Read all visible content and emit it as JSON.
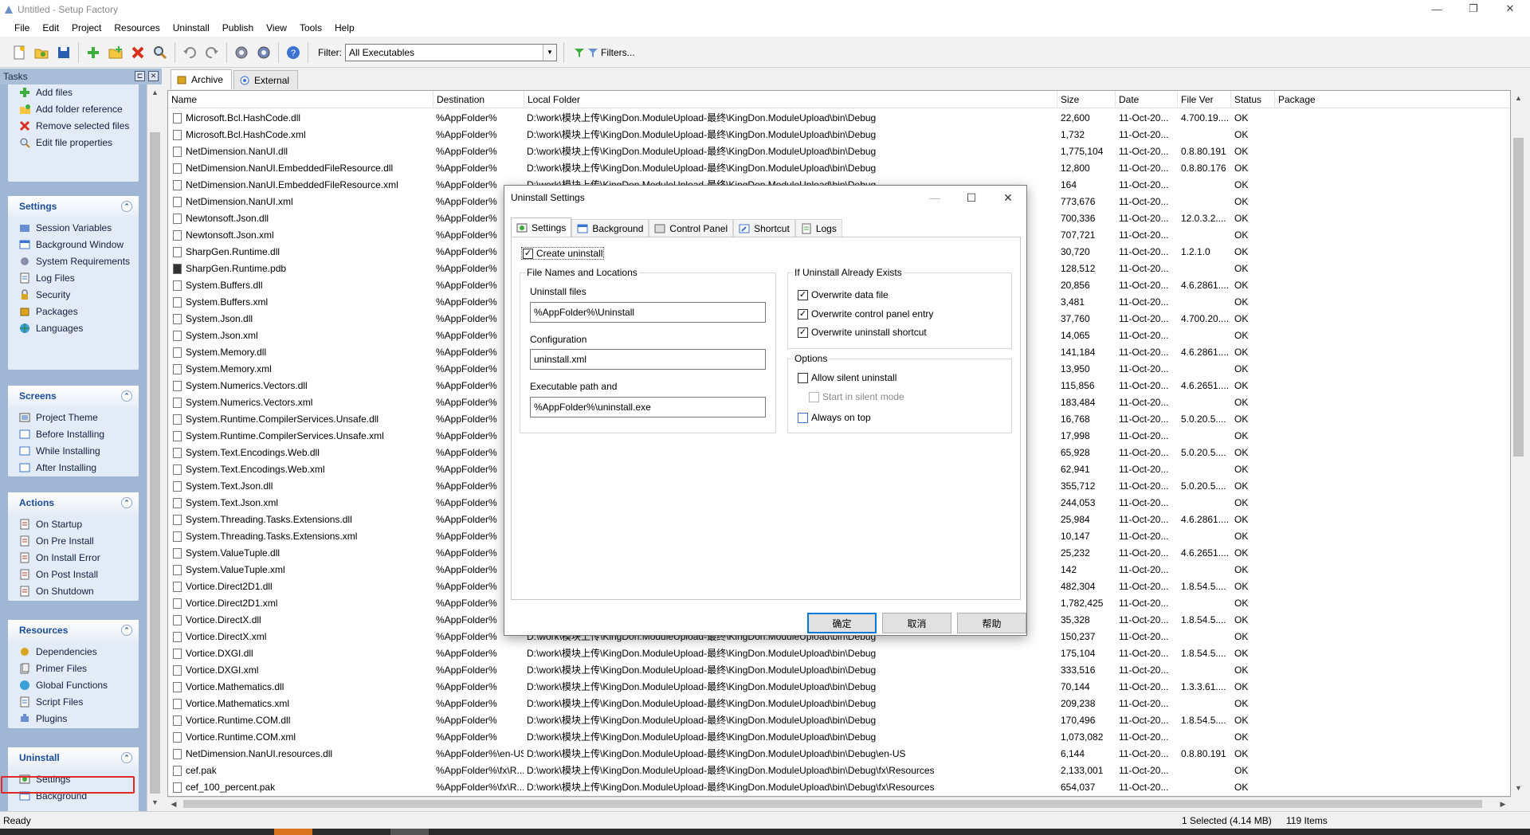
{
  "window": {
    "title": "Untitled - Setup Factory",
    "controls": [
      "—",
      "❐",
      "✕"
    ]
  },
  "menu": [
    "File",
    "Edit",
    "Project",
    "Resources",
    "Uninstall",
    "Publish",
    "View",
    "Tools",
    "Help"
  ],
  "toolbar": {
    "filter_label": "Filter:",
    "filter_value": "All Executables",
    "filters_button": "Filters..."
  },
  "tasks_panel": {
    "title": "Tasks",
    "top_items": [
      "Add files",
      "Add folder reference",
      "Remove selected files",
      "Edit file properties"
    ],
    "groups": [
      {
        "title": "Settings",
        "items": [
          "Session Variables",
          "Background Window",
          "System Requirements",
          "Log Files",
          "Security",
          "Packages",
          "Languages"
        ]
      },
      {
        "title": "Screens",
        "items": [
          "Project Theme",
          "Before Installing",
          "While Installing",
          "After Installing"
        ]
      },
      {
        "title": "Actions",
        "items": [
          "On Startup",
          "On Pre Install",
          "On Install Error",
          "On Post Install",
          "On Shutdown"
        ]
      },
      {
        "title": "Resources",
        "items": [
          "Dependencies",
          "Primer Files",
          "Global Functions",
          "Script Files",
          "Plugins"
        ]
      },
      {
        "title": "Uninstall",
        "items": [
          "Settings",
          "Background"
        ]
      }
    ]
  },
  "tabs": [
    "Archive",
    "External"
  ],
  "columns": [
    "Name",
    "Destination",
    "Local Folder",
    "Size",
    "Date",
    "File Ver",
    "Status",
    "Package"
  ],
  "files": [
    [
      "Microsoft.Bcl.HashCode.dll",
      "%AppFolder%",
      "D:\\work\\模块上传\\KingDon.ModuleUpload-最终\\KingDon.ModuleUpload\\bin\\Debug",
      "22,600",
      "11-Oct-20...",
      "4.700.19....",
      "OK"
    ],
    [
      "Microsoft.Bcl.HashCode.xml",
      "%AppFolder%",
      "D:\\work\\模块上传\\KingDon.ModuleUpload-最终\\KingDon.ModuleUpload\\bin\\Debug",
      "1,732",
      "11-Oct-20...",
      "",
      "OK"
    ],
    [
      "NetDimension.NanUI.dll",
      "%AppFolder%",
      "D:\\work\\模块上传\\KingDon.ModuleUpload-最终\\KingDon.ModuleUpload\\bin\\Debug",
      "1,775,104",
      "11-Oct-20...",
      "0.8.80.191",
      "OK"
    ],
    [
      "NetDimension.NanUI.EmbeddedFileResource.dll",
      "%AppFolder%",
      "D:\\work\\模块上传\\KingDon.ModuleUpload-最终\\KingDon.ModuleUpload\\bin\\Debug",
      "12,800",
      "11-Oct-20...",
      "0.8.80.176",
      "OK"
    ],
    [
      "NetDimension.NanUI.EmbeddedFileResource.xml",
      "%AppFolder%",
      "D:\\work\\模块上传\\KingDon.ModuleUpload-最终\\KingDon.ModuleUpload\\bin\\Debug",
      "164",
      "11-Oct-20...",
      "",
      "OK"
    ],
    [
      "NetDimension.NanUI.xml",
      "%AppFolder%",
      "",
      "773,676",
      "11-Oct-20...",
      "",
      "OK"
    ],
    [
      "Newtonsoft.Json.dll",
      "%AppFolder%",
      "",
      "700,336",
      "11-Oct-20...",
      "12.0.3.2....",
      "OK"
    ],
    [
      "Newtonsoft.Json.xml",
      "%AppFolder%",
      "",
      "707,721",
      "11-Oct-20...",
      "",
      "OK"
    ],
    [
      "SharpGen.Runtime.dll",
      "%AppFolder%",
      "",
      "30,720",
      "11-Oct-20...",
      "1.2.1.0",
      "OK"
    ],
    [
      "SharpGen.Runtime.pdb",
      "%AppFolder%",
      "",
      "128,512",
      "11-Oct-20...",
      "",
      "OK"
    ],
    [
      "System.Buffers.dll",
      "%AppFolder%",
      "",
      "20,856",
      "11-Oct-20...",
      "4.6.2861....",
      "OK"
    ],
    [
      "System.Buffers.xml",
      "%AppFolder%",
      "",
      "3,481",
      "11-Oct-20...",
      "",
      "OK"
    ],
    [
      "System.Json.dll",
      "%AppFolder%",
      "",
      "37,760",
      "11-Oct-20...",
      "4.700.20....",
      "OK"
    ],
    [
      "System.Json.xml",
      "%AppFolder%",
      "",
      "14,065",
      "11-Oct-20...",
      "",
      "OK"
    ],
    [
      "System.Memory.dll",
      "%AppFolder%",
      "",
      "141,184",
      "11-Oct-20...",
      "4.6.2861....",
      "OK"
    ],
    [
      "System.Memory.xml",
      "%AppFolder%",
      "",
      "13,950",
      "11-Oct-20...",
      "",
      "OK"
    ],
    [
      "System.Numerics.Vectors.dll",
      "%AppFolder%",
      "",
      "115,856",
      "11-Oct-20...",
      "4.6.2651....",
      "OK"
    ],
    [
      "System.Numerics.Vectors.xml",
      "%AppFolder%",
      "",
      "183,484",
      "11-Oct-20...",
      "",
      "OK"
    ],
    [
      "System.Runtime.CompilerServices.Unsafe.dll",
      "%AppFolder%",
      "",
      "16,768",
      "11-Oct-20...",
      "5.0.20.5....",
      "OK"
    ],
    [
      "System.Runtime.CompilerServices.Unsafe.xml",
      "%AppFolder%",
      "",
      "17,998",
      "11-Oct-20...",
      "",
      "OK"
    ],
    [
      "System.Text.Encodings.Web.dll",
      "%AppFolder%",
      "",
      "65,928",
      "11-Oct-20...",
      "5.0.20.5....",
      "OK"
    ],
    [
      "System.Text.Encodings.Web.xml",
      "%AppFolder%",
      "",
      "62,941",
      "11-Oct-20...",
      "",
      "OK"
    ],
    [
      "System.Text.Json.dll",
      "%AppFolder%",
      "",
      "355,712",
      "11-Oct-20...",
      "5.0.20.5....",
      "OK"
    ],
    [
      "System.Text.Json.xml",
      "%AppFolder%",
      "",
      "244,053",
      "11-Oct-20...",
      "",
      "OK"
    ],
    [
      "System.Threading.Tasks.Extensions.dll",
      "%AppFolder%",
      "",
      "25,984",
      "11-Oct-20...",
      "4.6.2861....",
      "OK"
    ],
    [
      "System.Threading.Tasks.Extensions.xml",
      "%AppFolder%",
      "",
      "10,147",
      "11-Oct-20...",
      "",
      "OK"
    ],
    [
      "System.ValueTuple.dll",
      "%AppFolder%",
      "",
      "25,232",
      "11-Oct-20...",
      "4.6.2651....",
      "OK"
    ],
    [
      "System.ValueTuple.xml",
      "%AppFolder%",
      "",
      "142",
      "11-Oct-20...",
      "",
      "OK"
    ],
    [
      "Vortice.Direct2D1.dll",
      "%AppFolder%",
      "",
      "482,304",
      "11-Oct-20...",
      "1.8.54.5....",
      "OK"
    ],
    [
      "Vortice.Direct2D1.xml",
      "%AppFolder%",
      "",
      "1,782,425",
      "11-Oct-20...",
      "",
      "OK"
    ],
    [
      "Vortice.DirectX.dll",
      "%AppFolder%",
      "",
      "35,328",
      "11-Oct-20...",
      "1.8.54.5....",
      "OK"
    ],
    [
      "Vortice.DirectX.xml",
      "%AppFolder%",
      "D:\\work\\模块上传\\KingDon.ModuleUpload-最终\\KingDon.ModuleUpload\\bin\\Debug",
      "150,237",
      "11-Oct-20...",
      "",
      "OK"
    ],
    [
      "Vortice.DXGI.dll",
      "%AppFolder%",
      "D:\\work\\模块上传\\KingDon.ModuleUpload-最终\\KingDon.ModuleUpload\\bin\\Debug",
      "175,104",
      "11-Oct-20...",
      "1.8.54.5....",
      "OK"
    ],
    [
      "Vortice.DXGI.xml",
      "%AppFolder%",
      "D:\\work\\模块上传\\KingDon.ModuleUpload-最终\\KingDon.ModuleUpload\\bin\\Debug",
      "333,516",
      "11-Oct-20...",
      "",
      "OK"
    ],
    [
      "Vortice.Mathematics.dll",
      "%AppFolder%",
      "D:\\work\\模块上传\\KingDon.ModuleUpload-最终\\KingDon.ModuleUpload\\bin\\Debug",
      "70,144",
      "11-Oct-20...",
      "1.3.3.61....",
      "OK"
    ],
    [
      "Vortice.Mathematics.xml",
      "%AppFolder%",
      "D:\\work\\模块上传\\KingDon.ModuleUpload-最终\\KingDon.ModuleUpload\\bin\\Debug",
      "209,238",
      "11-Oct-20...",
      "",
      "OK"
    ],
    [
      "Vortice.Runtime.COM.dll",
      "%AppFolder%",
      "D:\\work\\模块上传\\KingDon.ModuleUpload-最终\\KingDon.ModuleUpload\\bin\\Debug",
      "170,496",
      "11-Oct-20...",
      "1.8.54.5....",
      "OK"
    ],
    [
      "Vortice.Runtime.COM.xml",
      "%AppFolder%",
      "D:\\work\\模块上传\\KingDon.ModuleUpload-最终\\KingDon.ModuleUpload\\bin\\Debug",
      "1,073,082",
      "11-Oct-20...",
      "",
      "OK"
    ],
    [
      "NetDimension.NanUI.resources.dll",
      "%AppFolder%\\en-US",
      "D:\\work\\模块上传\\KingDon.ModuleUpload-最终\\KingDon.ModuleUpload\\bin\\Debug\\en-US",
      "6,144",
      "11-Oct-20...",
      "0.8.80.191",
      "OK"
    ],
    [
      "cef.pak",
      "%AppFolder%\\fx\\R...",
      "D:\\work\\模块上传\\KingDon.ModuleUpload-最终\\KingDon.ModuleUpload\\bin\\Debug\\fx\\Resources",
      "2,133,001",
      "11-Oct-20...",
      "",
      "OK"
    ],
    [
      "cef_100_percent.pak",
      "%AppFolder%\\fx\\R...",
      "D:\\work\\模块上传\\KingDon.ModuleUpload-最终\\KingDon.ModuleUpload\\bin\\Debug\\fx\\Resources",
      "654,037",
      "11-Oct-20...",
      "",
      "OK"
    ]
  ],
  "status": {
    "left": "Ready",
    "selected": "1 Selected (4.14 MB)",
    "items": "119 Items"
  },
  "dialog": {
    "title": "Uninstall Settings",
    "tabs": [
      "Settings",
      "Background",
      "Control Panel",
      "Shortcut",
      "Logs"
    ],
    "create_uninstall": "Create uninstall",
    "file_names_group": "File Names and Locations",
    "uninstall_files_label": "Uninstall files",
    "uninstall_files_value": "%AppFolder%\\Uninstall",
    "configuration_label": "Configuration",
    "configuration_value": "uninstall.xml",
    "exe_path_label": "Executable path and",
    "exe_path_value": "%AppFolder%\\uninstall.exe",
    "exists_group": "If Uninstall Already Exists",
    "overwrite_data": "Overwrite data file",
    "overwrite_cp": "Overwrite control panel entry",
    "overwrite_shortcut": "Overwrite uninstall shortcut",
    "options_group": "Options",
    "allow_silent": "Allow silent uninstall",
    "start_silent": "Start in silent mode",
    "always_top": "Always on top",
    "ok": "确定",
    "cancel": "取消",
    "help": "帮助"
  },
  "colors": {
    "tasks_bg": "#9fb6d4",
    "group_title": "#1b4c9a",
    "highlight": "#e02a2a",
    "default_button": "#0078d7"
  }
}
